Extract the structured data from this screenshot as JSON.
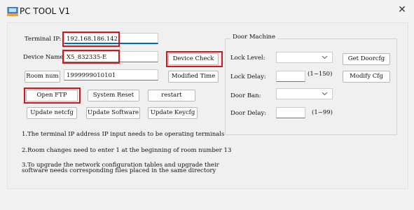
{
  "window": {
    "title": "PC TOOL V1",
    "app_icon": "pc-tool-icon",
    "close_icon": "close-icon"
  },
  "left": {
    "terminal_ip_label": "Terminal IP:",
    "terminal_ip_value": "192.168.186.142",
    "device_name_label": "Device Name:",
    "device_name_value": "X5_832335-E",
    "device_check_label": "Device Check",
    "room_num_button": "Room num",
    "room_num_value": "1999999010101",
    "modified_time_label": "Modified Time",
    "open_ftp_label": "Open FTP",
    "system_reset_label": "System Reset",
    "restart_label": "restart",
    "update_netcfg_label": "Update netcfg",
    "update_software_label": "Update Software",
    "update_keycfg_label": "Update Keycfg"
  },
  "door_machine": {
    "title": "Door Machine",
    "lock_level_label": "Lock Level:",
    "lock_level_value": "",
    "get_doorcfg_label": "Get Doorcfg",
    "lock_delay_label": "Lock Delay:",
    "lock_delay_value": "",
    "lock_delay_range": "(1~150)",
    "modify_cfg_label": "Modify Cfg",
    "door_ban_label": "Door Ban:",
    "door_ban_value": "",
    "door_delay_label": "Door Delay:",
    "door_delay_value": "",
    "door_delay_range": "(1~99)"
  },
  "notes": {
    "note1": "1.The terminal IP address IP input needs to be operating terminals",
    "note2": "2.Room changes need to enter 1 at the beginning of room number 13",
    "note3_line1": "3.To upgrade the network configuration tables and upgrade their",
    "note3_line2": "software needs corresponding files placed in the same directory"
  },
  "colors": {
    "highlight": "#d5161e",
    "accent": "#0067c0"
  }
}
